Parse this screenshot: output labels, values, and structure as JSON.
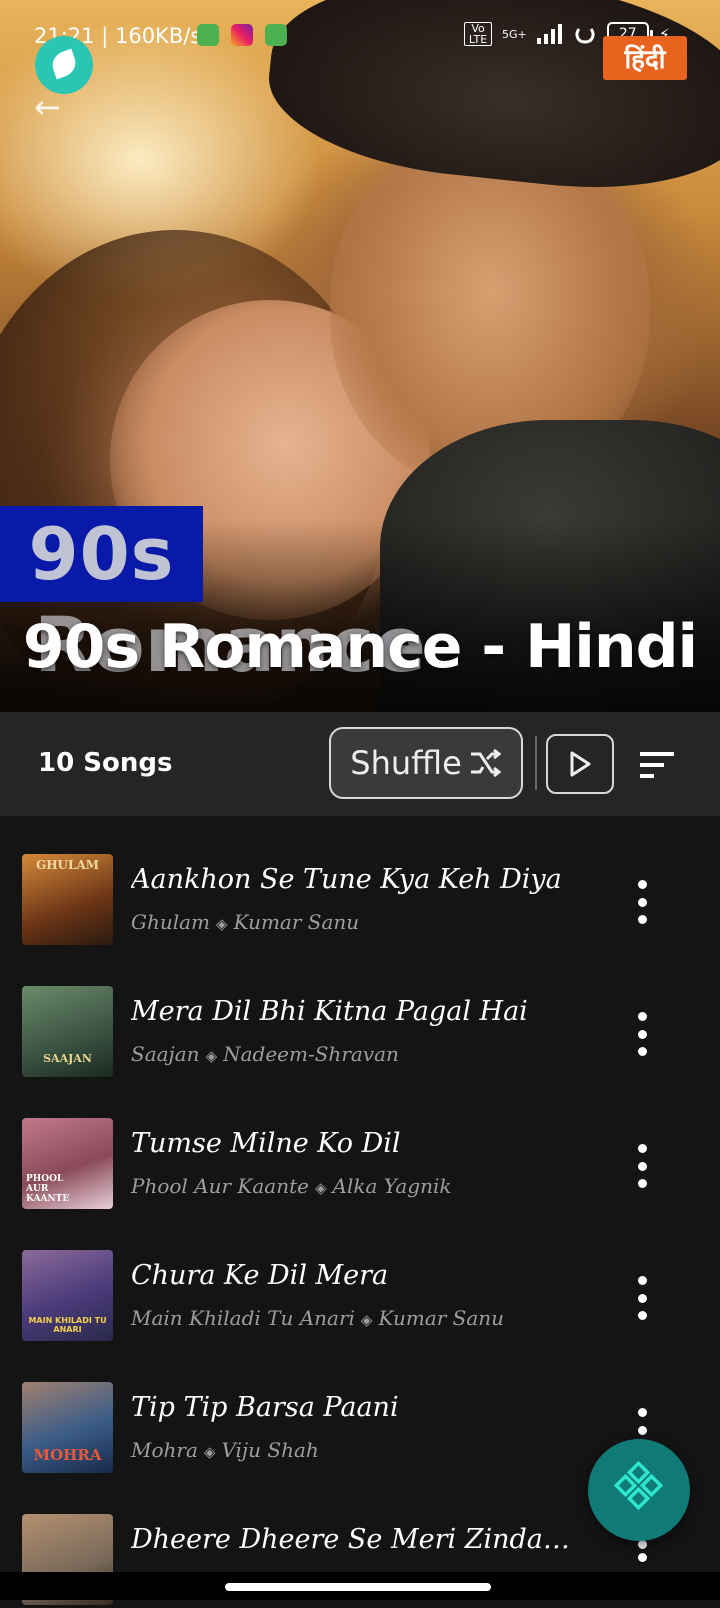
{
  "status_bar": {
    "time": "21:21",
    "speed": "160KB/s",
    "network_volte": "Vo LTE",
    "network_5g": "5G+",
    "battery": "27"
  },
  "header": {
    "language_button": "हिंदी",
    "badge_text": "90s",
    "ghost_text": "Romance",
    "playlist_title": "90s Romance - Hindi"
  },
  "controls": {
    "song_count": "10 Songs",
    "shuffle_label": "Shuffle"
  },
  "songs": [
    {
      "title": "Aankhon Se Tune Kya Keh Diya",
      "album": "Ghulam",
      "artist": "Kumar Sanu",
      "thumb_label": "GHULAM",
      "thumb_color": "#8a4b1e"
    },
    {
      "title": "Mera Dil Bhi Kitna Pagal Hai",
      "album": "Saajan",
      "artist": "Nadeem-Shravan",
      "thumb_label": "SAAJAN",
      "thumb_color": "#4a6b52"
    },
    {
      "title": "Tumse Milne Ko Dil",
      "album": "Phool Aur Kaante",
      "artist": "Alka Yagnik",
      "thumb_label": "PHOOL AUR KAANTE",
      "thumb_color": "#9c5a6a"
    },
    {
      "title": "Chura Ke Dil Mera",
      "album": "Main Khiladi Tu Anari",
      "artist": "Kumar Sanu",
      "thumb_label": "MAIN KHILADI TU ANARI",
      "thumb_color": "#5a5a9a"
    },
    {
      "title": "Tip Tip Barsa Paani",
      "album": "Mohra",
      "artist": "Viju Shah",
      "thumb_label": "MOHRA",
      "thumb_color": "#3a5c88"
    },
    {
      "title": "Dheere Dheere Se Meri Zindagi Mei...",
      "album": "",
      "artist": "",
      "thumb_label": "",
      "thumb_color": "#7a6a5a"
    }
  ],
  "colors": {
    "accent_teal": "#2bc5b4",
    "fab": "#0f7a76",
    "language_button": "#e8641e",
    "badge_blue": "#0a1aa8"
  }
}
